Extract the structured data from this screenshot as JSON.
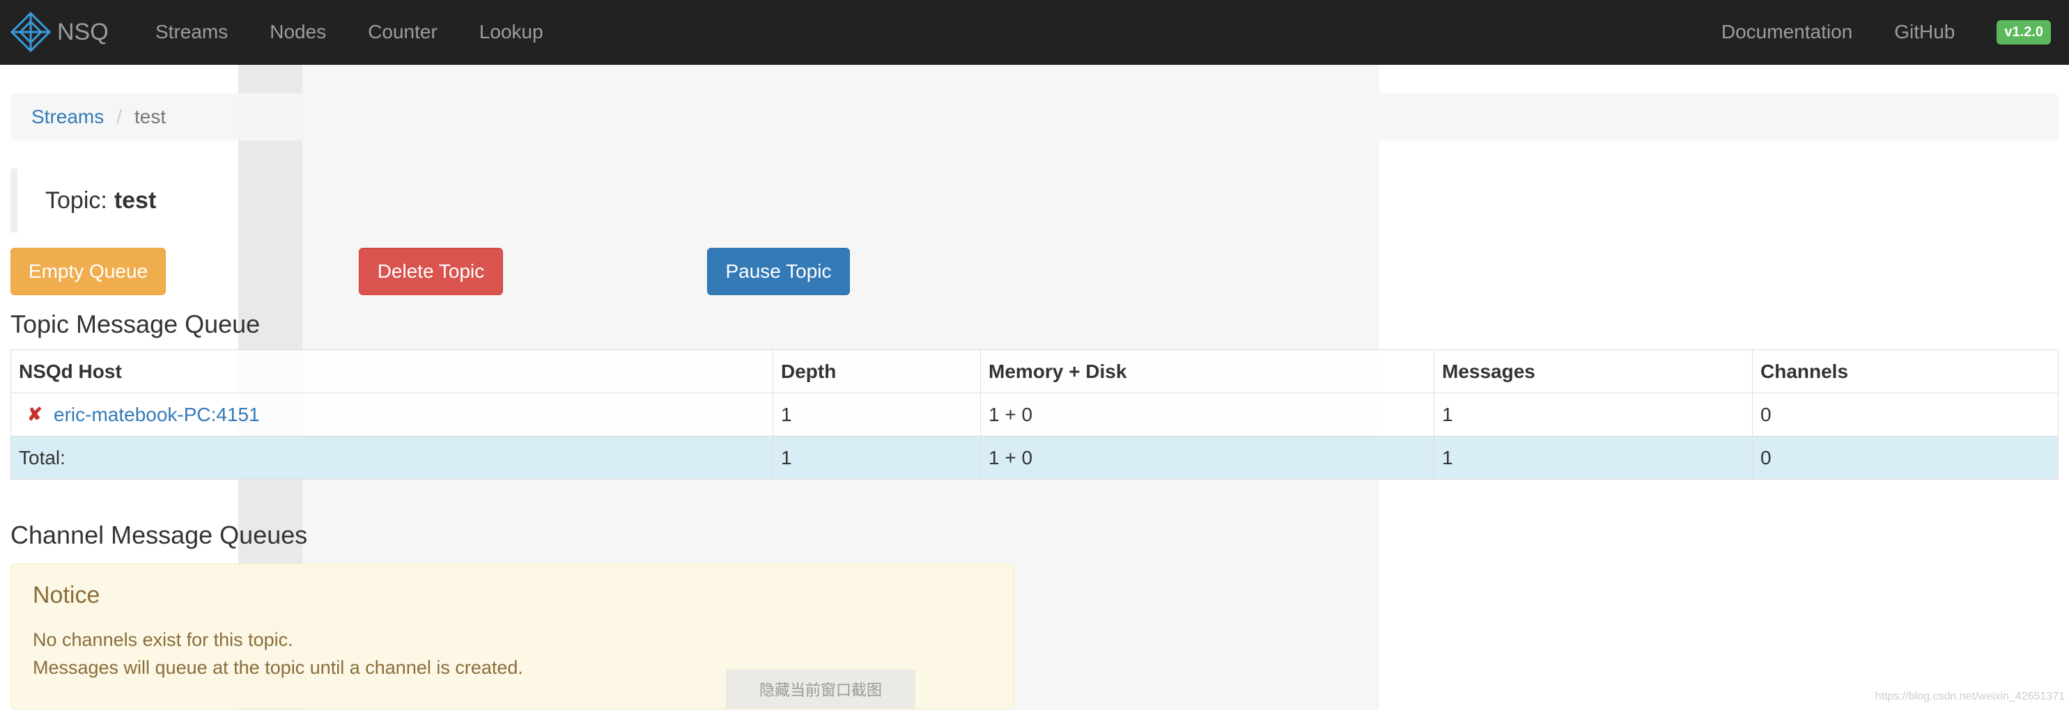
{
  "navbar": {
    "brand": "NSQ",
    "links": [
      "Streams",
      "Nodes",
      "Counter",
      "Lookup"
    ],
    "right_links": [
      "Documentation",
      "GitHub"
    ],
    "version": "v1.2.0"
  },
  "breadcrumb": {
    "root": "Streams",
    "separator": "/",
    "current": "test"
  },
  "topic": {
    "label": "Topic:",
    "name": "test"
  },
  "buttons": {
    "empty_queue": "Empty Queue",
    "delete_topic": "Delete Topic",
    "pause_topic": "Pause Topic"
  },
  "topic_queue": {
    "title": "Topic Message Queue",
    "headers": [
      "NSQd Host",
      "Depth",
      "Memory + Disk",
      "Messages",
      "Channels"
    ],
    "rows": [
      {
        "host": "eric-matebook-PC:4151",
        "depth": "1",
        "memory_disk": "1 + 0",
        "messages": "1",
        "channels": "0"
      }
    ],
    "total": {
      "label": "Total:",
      "depth": "1",
      "memory_disk": "1 + 0",
      "messages": "1",
      "channels": "0"
    }
  },
  "channel_queues": {
    "title": "Channel Message Queues",
    "notice_title": "Notice",
    "notice_line1": "No channels exist for this topic.",
    "notice_line2": "Messages will queue at the topic until a channel is created."
  },
  "overlay": {
    "hide_screenshot_button": "隐藏当前窗口截图",
    "watermark": "https://blog.csdn.net/weixin_42651371"
  },
  "colors": {
    "navbar_bg": "#222222",
    "warning": "#f0ad4e",
    "danger": "#d9534f",
    "primary": "#337ab7",
    "success_badge": "#5cb85c",
    "total_row": "#d9edf7",
    "notice_bg": "#fcf8e3"
  },
  "icons": {
    "brand": "nsq-logo-icon",
    "host_status": "x-mark-icon"
  }
}
